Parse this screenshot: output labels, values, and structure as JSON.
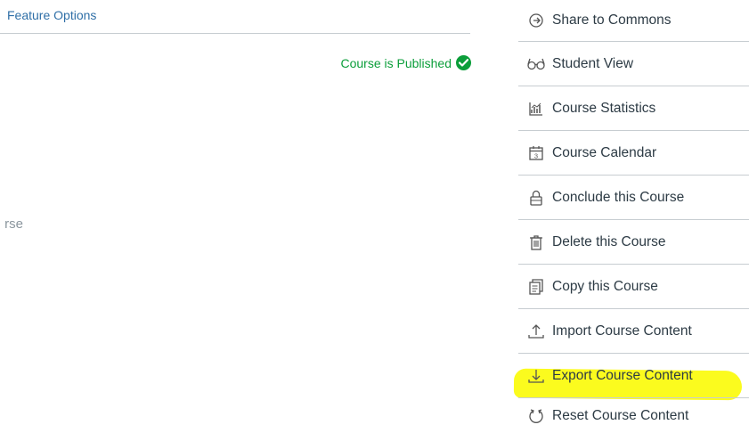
{
  "feature_options": {
    "label": "Feature Options"
  },
  "status": {
    "published_text": "Course is Published",
    "color": "#0b9e3a"
  },
  "partial_text": "rse",
  "highlight_color": "#fbfb1e",
  "menu": {
    "items": [
      {
        "label": "Share to Commons",
        "icon": "share-commons-icon"
      },
      {
        "label": "Student View",
        "icon": "glasses-icon"
      },
      {
        "label": "Course Statistics",
        "icon": "statistics-icon"
      },
      {
        "label": "Course Calendar",
        "icon": "calendar-icon",
        "icon_text": "3"
      },
      {
        "label": "Conclude this Course",
        "icon": "lock-icon"
      },
      {
        "label": "Delete this Course",
        "icon": "trash-icon"
      },
      {
        "label": "Copy this Course",
        "icon": "copy-icon"
      },
      {
        "label": "Import Course Content",
        "icon": "upload-icon"
      },
      {
        "label": "Export Course Content",
        "icon": "download-icon",
        "highlighted": true
      },
      {
        "label": "Reset Course Content",
        "icon": "reset-icon"
      }
    ]
  }
}
